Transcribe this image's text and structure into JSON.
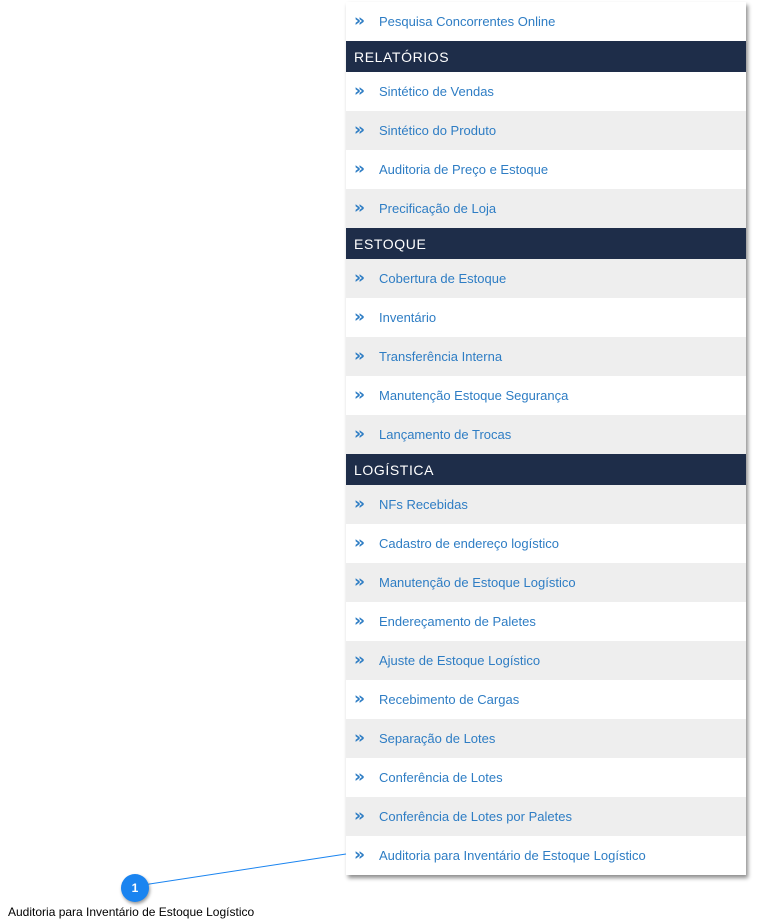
{
  "menu": {
    "top_item": {
      "label": "Pesquisa Concorrentes Online"
    },
    "sections": [
      {
        "title": "RELATÓRIOS",
        "items": [
          {
            "label": "Sintético de Vendas"
          },
          {
            "label": "Sintético do Produto"
          },
          {
            "label": "Auditoria de Preço e Estoque"
          },
          {
            "label": "Precificação de Loja"
          }
        ]
      },
      {
        "title": "ESTOQUE",
        "items": [
          {
            "label": "Cobertura de Estoque"
          },
          {
            "label": "Inventário"
          },
          {
            "label": "Transferência Interna"
          },
          {
            "label": "Manutenção Estoque Segurança"
          },
          {
            "label": "Lançamento de Trocas"
          }
        ]
      },
      {
        "title": "LOGÍSTICA",
        "items": [
          {
            "label": "NFs Recebidas"
          },
          {
            "label": "Cadastro de endereço logístico"
          },
          {
            "label": "Manutenção de Estoque Logístico"
          },
          {
            "label": "Endereçamento de Paletes"
          },
          {
            "label": "Ajuste de Estoque Logístico"
          },
          {
            "label": "Recebimento de Cargas"
          },
          {
            "label": "Separação de Lotes"
          },
          {
            "label": "Conferência de Lotes"
          },
          {
            "label": "Conferência de Lotes por Paletes"
          },
          {
            "label": "Auditoria para Inventário de Estoque Logístico"
          }
        ]
      }
    ],
    "chevron_glyph": "»",
    "icon": "double-chevron-right-icon"
  },
  "callout": {
    "number": "1",
    "caption": "Auditoria para Inventário de Estoque Logístico",
    "badge_color": "#1a84f0"
  },
  "colors": {
    "header_bg": "#1e2d49",
    "link": "#2e7dc4",
    "row_alt": "#eeeeee"
  }
}
